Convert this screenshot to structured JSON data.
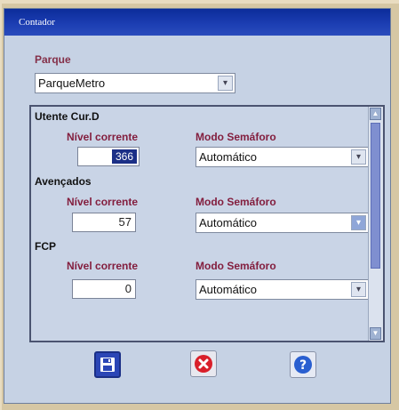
{
  "window": {
    "title": "Contador"
  },
  "parque": {
    "label": "Parque",
    "value": "ParqueMetro"
  },
  "sections": [
    {
      "name": "Utente Cur.D",
      "nivel_label": "Nível corrente",
      "nivel_value": "366",
      "modo_label": "Modo Semáforo",
      "modo_value": "Automático"
    },
    {
      "name": "Avençados",
      "nivel_label": "Nível corrente",
      "nivel_value": "57",
      "modo_label": "Modo Semáforo",
      "modo_value": "Automático"
    },
    {
      "name": "FCP",
      "nivel_label": "Nível corrente",
      "nivel_value": "0",
      "modo_label": "Modo Semáforo",
      "modo_value": "Automático"
    }
  ],
  "icons": {
    "save": "floppy-disk-icon",
    "cancel": "red-x-icon",
    "help": "question-mark-icon",
    "combo": "chevron-down-icon"
  },
  "colors": {
    "title_bar": "#1d3fb4",
    "label_text": "#842f48",
    "panel_bg": "#c9d4e6"
  }
}
